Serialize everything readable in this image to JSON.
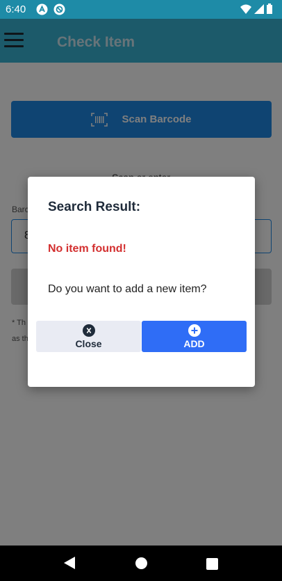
{
  "status_bar": {
    "time": "6:40"
  },
  "app_bar": {
    "title": "Check Item"
  },
  "scan_button": {
    "label": "Scan Barcode"
  },
  "scan_text": "Scan or enter",
  "barcode_field": {
    "label": "Barc",
    "value": "8"
  },
  "notes": [
    "* Th",
    "as th"
  ],
  "dialog": {
    "title": "Search Result:",
    "error": "No item found!",
    "question": "Do you want to add a new item?",
    "close_label": "Close",
    "add_label": "ADD"
  },
  "colors": {
    "app_bar": "#39b4d4",
    "status_bar": "#1e8ba7",
    "primary": "#1e88e5",
    "add_button": "#2f6df6",
    "close_button": "#e9ebf3",
    "error": "#d32f2f"
  },
  "icons": [
    "menu-icon",
    "barcode-icon",
    "close-circle-icon",
    "add-circle-icon",
    "wifi-icon",
    "signal-icon",
    "battery-icon",
    "back-icon",
    "home-icon",
    "recents-icon"
  ]
}
